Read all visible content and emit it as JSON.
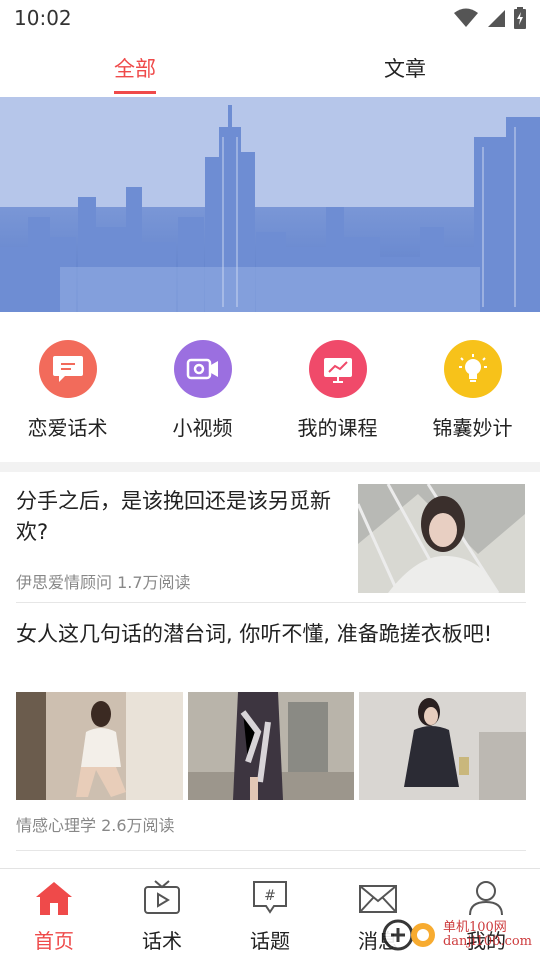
{
  "status_bar": {
    "time": "10:02",
    "icons": [
      "wifi-icon",
      "signal-icon",
      "battery-icon"
    ]
  },
  "top_tabs": [
    {
      "label": "全部",
      "active": true
    },
    {
      "label": "文章",
      "active": false
    }
  ],
  "categories": [
    {
      "label": "恋爱话术",
      "icon": "chat-bubble-icon",
      "color": "#f26b5b"
    },
    {
      "label": "小视频",
      "icon": "video-camera-icon",
      "color": "#9b6fe0"
    },
    {
      "label": "我的课程",
      "icon": "course-board-icon",
      "color": "#f04a6a"
    },
    {
      "label": "锦囊妙计",
      "icon": "lightbulb-icon",
      "color": "#f7c21a"
    }
  ],
  "articles": [
    {
      "title": "分手之后，是该挽回还是该另觅新欢?",
      "source": "伊思爱情顾问",
      "reads": "1.7万阅读"
    },
    {
      "title": "女人这几句话的潜台词, 你听不懂, 准备跪搓衣板吧!",
      "source": "情感心理学",
      "reads": "2.6万阅读"
    }
  ],
  "bottom_nav": [
    {
      "label": "首页",
      "icon": "home-icon",
      "active": true
    },
    {
      "label": "话术",
      "icon": "tv-icon",
      "active": false
    },
    {
      "label": "话题",
      "icon": "hashtag-bubble-icon",
      "active": false
    },
    {
      "label": "消息",
      "icon": "mail-icon",
      "active": false
    },
    {
      "label": "我的",
      "icon": "user-icon",
      "active": false
    }
  ],
  "watermark": {
    "line1": "单机100网",
    "line2": "danji100.com"
  },
  "colors": {
    "accent": "#ef4a4a"
  }
}
